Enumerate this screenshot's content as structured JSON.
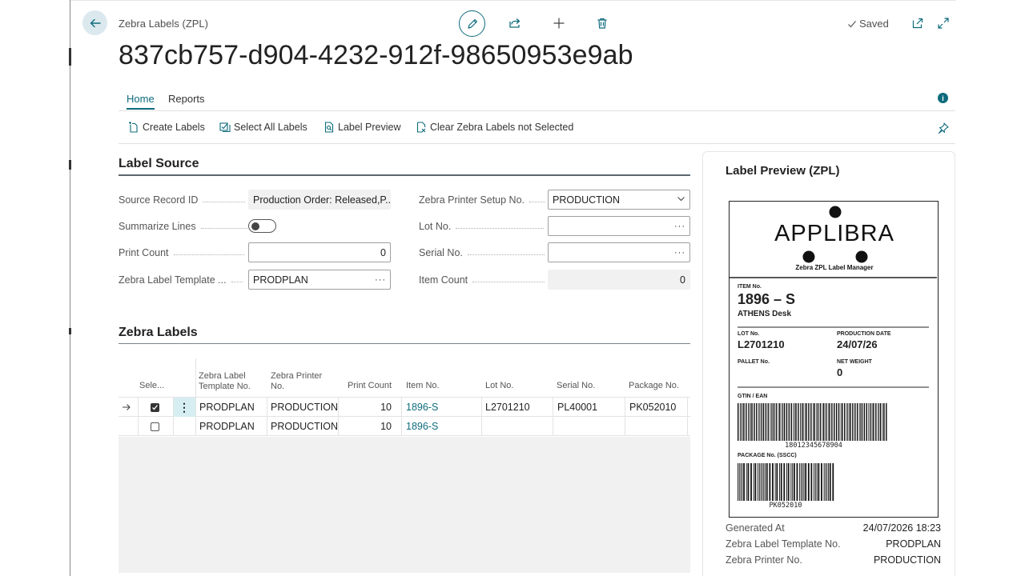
{
  "header": {
    "breadcrumb": "Zebra Labels (ZPL)",
    "record_title": "837cb757-d904-4232-912f-98650953e9ab",
    "saved_label": "Saved"
  },
  "tabs": [
    {
      "label": "Home",
      "active": true
    },
    {
      "label": "Reports",
      "active": false
    }
  ],
  "actions": [
    {
      "label": "Create Labels",
      "icon": "create-labels-icon"
    },
    {
      "label": "Select All Labels",
      "icon": "select-all-icon"
    },
    {
      "label": "Label Preview",
      "icon": "label-preview-icon"
    },
    {
      "label": "Clear Zebra Labels not Selected",
      "icon": "clear-labels-icon"
    }
  ],
  "label_source": {
    "title": "Label Source",
    "source_record_id": {
      "label": "Source Record ID",
      "value": "Production Order: Released,P..."
    },
    "summarize_lines": {
      "label": "Summarize Lines",
      "value": "off"
    },
    "print_count": {
      "label": "Print Count",
      "value": "0"
    },
    "label_template": {
      "label": "Zebra Label Template ...",
      "value": "PRODPLAN"
    },
    "printer_setup": {
      "label": "Zebra Printer Setup No.",
      "value": "PRODUCTION"
    },
    "lot_no": {
      "label": "Lot No.",
      "value": ""
    },
    "serial_no": {
      "label": "Serial No.",
      "value": ""
    },
    "item_count": {
      "label": "Item Count",
      "value": "0"
    }
  },
  "zebra_labels": {
    "title": "Zebra Labels",
    "columns": {
      "select": "Sele...",
      "template_line1": "Zebra Label",
      "template_line2": "Template No.",
      "printer_line1": "Zebra Printer",
      "printer_line2": "No.",
      "print_count": "Print Count",
      "item_no": "Item No.",
      "lot_no": "Lot No.",
      "serial_no": "Serial No.",
      "package_no": "Package No."
    },
    "rows": [
      {
        "selected": true,
        "template": "PRODPLAN",
        "printer": "PRODUCTION",
        "print_count": "10",
        "item_no": "1896-S",
        "lot_no": "L2701210",
        "serial_no": "PL40001",
        "package_no": "PK052010"
      },
      {
        "selected": false,
        "template": "PRODPLAN",
        "printer": "PRODUCTION",
        "print_count": "10",
        "item_no": "1896-S",
        "lot_no": "",
        "serial_no": "",
        "package_no": ""
      }
    ]
  },
  "preview": {
    "title": "Label Preview (ZPL)",
    "label": {
      "brand": "APPLIBRA",
      "tagline": "Zebra ZPL Label Manager",
      "item_no_caption": "ITEM No.",
      "item_no": "1896 – S",
      "item_desc": "ATHENS Desk",
      "lot_caption": "LOT No.",
      "lot": "L2701210",
      "prod_date_caption": "PRODUCTION DATE",
      "prod_date": "24/07/26",
      "pallet_caption": "PALLET No.",
      "weight_caption": "NET WEIGHT",
      "weight": "0",
      "gtin_caption": "GTIN / EAN",
      "gtin": "18012345678904",
      "package_caption": "PACKAGE No. (SSCC)",
      "package": "PK052010"
    },
    "fields": [
      {
        "label": "Generated At",
        "value": "24/07/2026 18:23"
      },
      {
        "label": "Zebra Label Template No.",
        "value": "PRODPLAN"
      },
      {
        "label": "Zebra Printer No.",
        "value": "PRODUCTION"
      }
    ]
  },
  "colors": {
    "accent": "#0e6b7c",
    "back_button_bg": "#dbe9ef"
  }
}
